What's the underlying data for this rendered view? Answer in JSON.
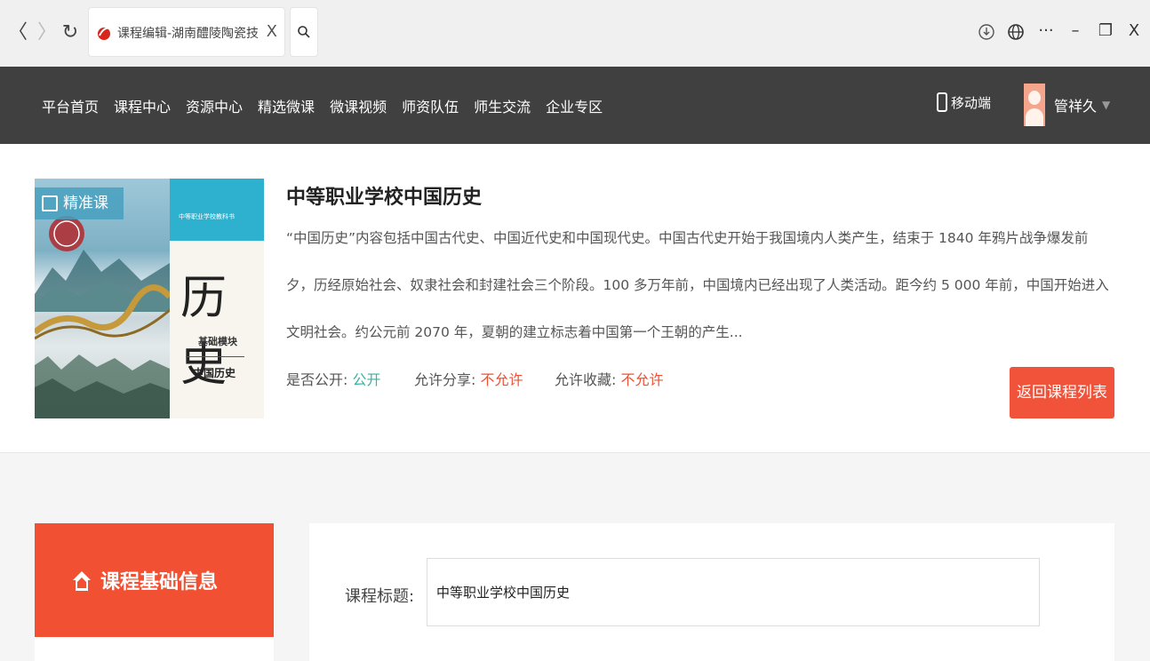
{
  "browser": {
    "back": "〈",
    "forward": "〉",
    "refresh": "↻",
    "tab_title": "课程编辑-湖南醴陵陶瓷技师学",
    "tab_close": "X",
    "controls": {
      "download": "⊕",
      "globe": "⊕",
      "more": "···",
      "minimize": "–",
      "restore": "❐",
      "close": "X"
    }
  },
  "topnav": {
    "items": [
      "平台首页",
      "课程中心",
      "资源中心",
      "精选微课",
      "微课视频",
      "师资队伍",
      "师生交流",
      "企业专区"
    ],
    "mobile": "移动端",
    "user": "管祥久"
  },
  "course": {
    "cover": {
      "badge": "精准课",
      "series": "中等职业学校教科书",
      "big_title": "历史",
      "module": "基础模块",
      "subject": "中国历史"
    },
    "title": "中等职业学校中国历史",
    "description": "“中国历史”内容包括中国古代史、中国近代史和中国现代史。中国古代史开始于我国境内人类产生，结束于 1840 年鸦片战争爆发前夕，历经原始社会、奴隶社会和封建社会三个阶段。100 多万年前，中国境内已经出现了人类活动。距今约 5 000 年前，中国开始进入文明社会。约公元前 2070 年，夏朝的建立标志着中国第一个王朝的产生...",
    "public_label": "是否公开:",
    "public_value": "公开",
    "share_label": "允许分享:",
    "share_value": "不允许",
    "collect_label": "允许收藏:",
    "collect_value": "不允许",
    "back_button": "返回课程列表"
  },
  "sidebar": {
    "active": "课程基础信息"
  },
  "form": {
    "title_label": "课程标题:",
    "title_value": "中等职业学校中国历史"
  },
  "colors": {
    "accent": "#f25033",
    "topbar": "#404040",
    "green": "#37b3a3"
  }
}
